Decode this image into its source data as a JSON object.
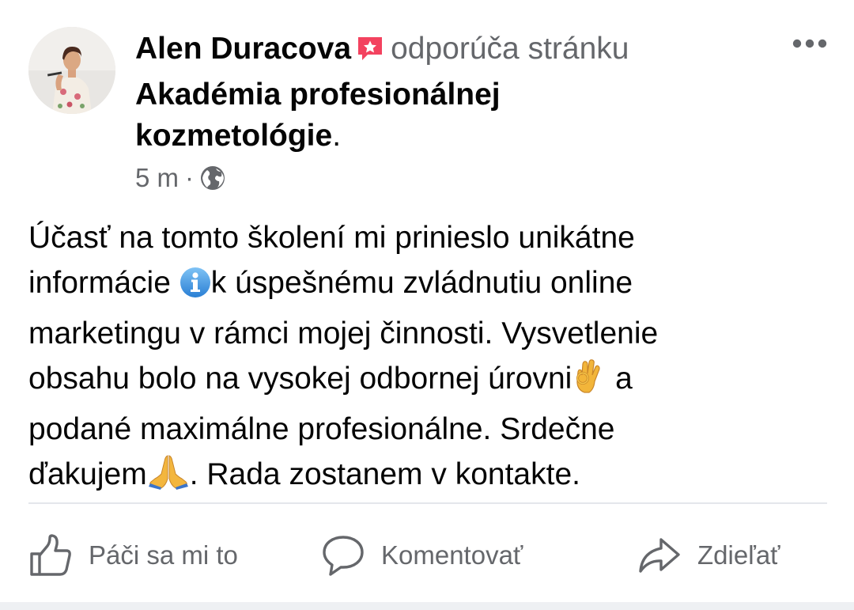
{
  "post": {
    "author": "Alen Duracova",
    "recommend_icon": "recommend-star-icon",
    "recommends_text": "odporúča stránku",
    "page_name_line1": "Akadémia profesionálnej",
    "page_name_line2": "kozmetológie",
    "page_name_suffix": ".",
    "time": "5 m",
    "separator": "·",
    "privacy_icon": "globe-icon",
    "body": {
      "l1": "Účasť na tomto školení mi prinieslo unikátne",
      "l2a": "informácie ",
      "l2b": "k úspešnému zvládnutiu online",
      "l3": "marketingu v rámci mojej činnosti. Vysvetlenie",
      "l4a": "obsahu bolo na vysokej odbornej úrovni",
      "l4b": " a",
      "l5": "podané maximálne profesionálne. Srdečne",
      "l6a": "ďakujem",
      "l6b": ". Rada zostanem v kontakte."
    },
    "emojis": [
      "information-icon",
      "ok-hand-icon",
      "folded-hands-icon"
    ]
  },
  "actions": {
    "like_label": "Páči sa mi to",
    "comment_label": "Komentovať",
    "share_label": "Zdieľať"
  },
  "colors": {
    "text": "#050505",
    "secondary": "#65676b",
    "recommend": "#f3425f",
    "divider": "#e4e6eb"
  }
}
